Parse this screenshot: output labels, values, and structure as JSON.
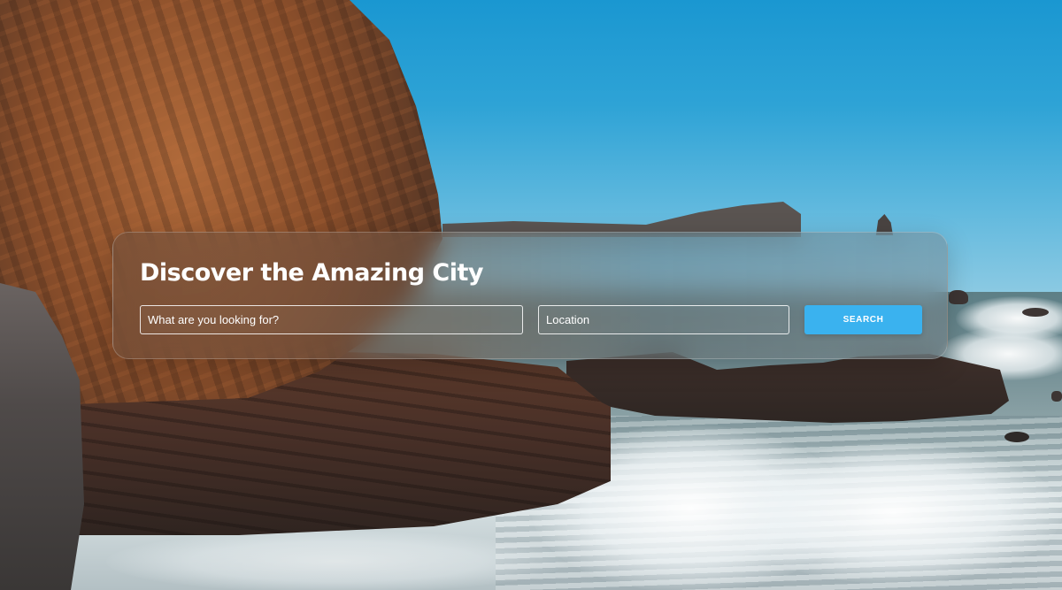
{
  "hero": {
    "title": "Discover the Amazing City"
  },
  "search": {
    "query_placeholder": "What are you looking for?",
    "query_value": "",
    "location_placeholder": "Location",
    "location_value": "",
    "button_label": "SEARCH",
    "button_color": "#3ab2ef"
  }
}
